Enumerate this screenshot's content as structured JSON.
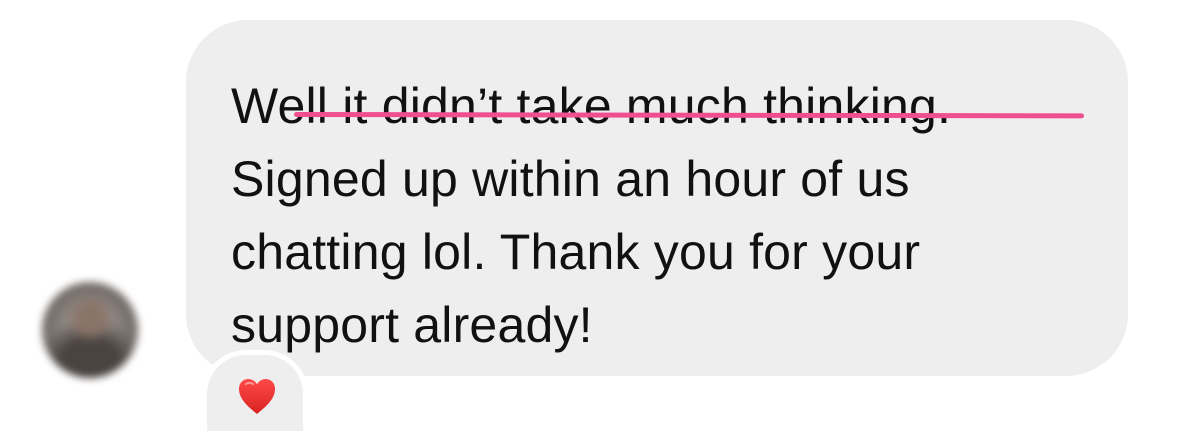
{
  "conversation": {
    "message": {
      "text": "Well it didn’t take much thinking.\nSigned up within an hour of us\nchatting lol. Thank you for your\nsupport already!"
    },
    "reaction": {
      "icon": "heart-icon",
      "color": "#e63a3a"
    },
    "avatar": {
      "description_hidden": true
    },
    "underline_color": "#ef4f8d",
    "bubble_color": "#eeeeee"
  }
}
